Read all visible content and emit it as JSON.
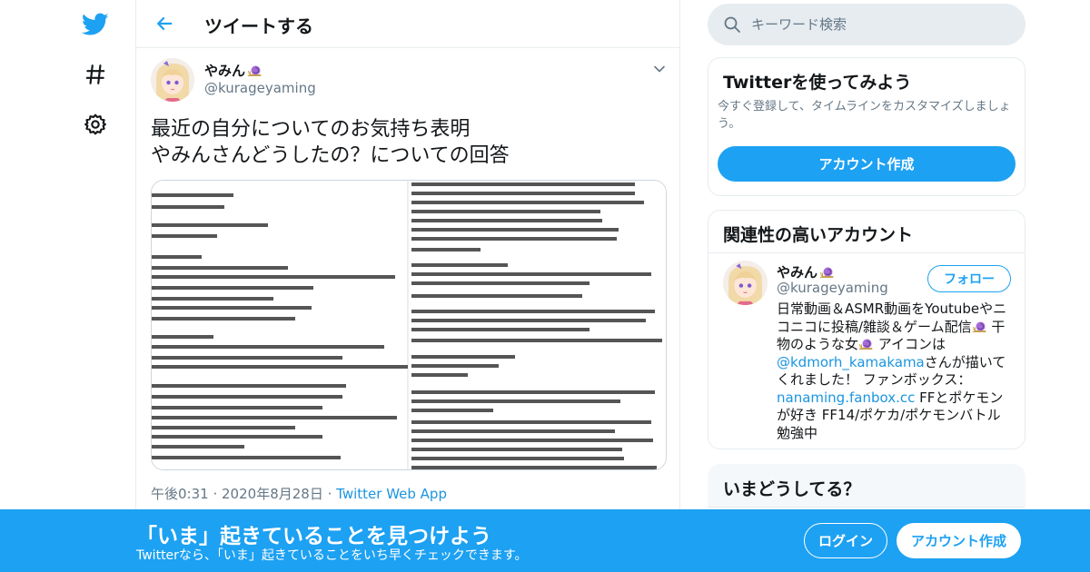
{
  "colors": {
    "accent": "#1da1f2",
    "link": "#1b95e0",
    "muted": "#657786",
    "border": "#e6ecf0"
  },
  "icons": [
    "twitter-bird-icon",
    "hashtag-icon",
    "gear-icon",
    "back-arrow-icon",
    "chevron-down-icon",
    "search-icon",
    "snail-emoji-icon"
  ],
  "header": {
    "title": "ツイートする"
  },
  "tweet": {
    "name": "やみん",
    "handle": "@kurageyaming",
    "text_lines": [
      "最近の自分についてのお気持ち表明",
      "やみんさんどうしたの？についての回答"
    ],
    "time": "午後0:31",
    "date": "2020年8月28日",
    "source": "Twitter Web App"
  },
  "search": {
    "placeholder": "キーワード検索"
  },
  "signup_card": {
    "title": "Twitterを使ってみよう",
    "description": "今すぐ登録して、タイムラインをカスタマイズしましょう。",
    "button": "アカウント作成"
  },
  "related": {
    "title": "関連性の高いアカウント",
    "account": {
      "name": "やみん",
      "handle": "@kurageyaming",
      "follow_label": "フォロー",
      "bio_1": "日常動画＆ASMR動画をYoutubeやニコニコに投稿/雑談＆ゲーム配信",
      "bio_2": " 干物のような女",
      "bio_3": " アイコンは",
      "bio_mention": "@kdmorh_kamakama",
      "bio_4": "さんが描いてくれました！ ファンボックス：",
      "bio_link": "nanaming.fanbox.cc",
      "bio_5": " FFとポケモンが好き FF14/ポケカ/ポケモンバトル勉強中"
    }
  },
  "trends": {
    "title": "いまどうしてる？"
  },
  "bottom_bar": {
    "title": "「いま」起きていることを見つけよう",
    "subtitle": "Twitterなら、「いま」起きていることをいち早くチェックできます。",
    "login": "ログイン",
    "signup": "アカウント作成"
  }
}
